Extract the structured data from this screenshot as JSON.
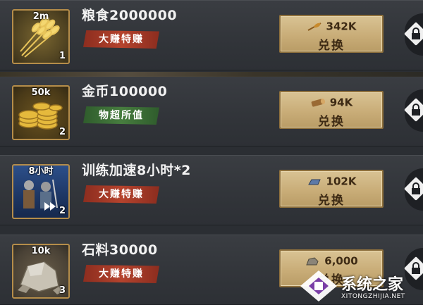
{
  "items": [
    {
      "quantity": "2m",
      "tier": "1",
      "name": "粮食2000000",
      "tag": "大赚特赚",
      "tag_style": "red",
      "cost": "342K",
      "cost_icon": "wheat-icon",
      "button_label": "兑换",
      "icon": "wheat-bundle-icon"
    },
    {
      "quantity": "50k",
      "tier": "2",
      "name": "金币100000",
      "tag": "物超所值",
      "tag_style": "green",
      "cost": "94K",
      "cost_icon": "wood-log-icon",
      "button_label": "兑换",
      "icon": "gold-coins-icon"
    },
    {
      "quantity": "8小时",
      "tier": "2",
      "name": "训练加速8小时*2",
      "tag": "大赚特赚",
      "tag_style": "red",
      "cost": "102K",
      "cost_icon": "iron-bar-icon",
      "button_label": "兑换",
      "icon": "soldiers-speedup-icon"
    },
    {
      "quantity": "10k",
      "tier": "3",
      "name": "石料30000",
      "tag": "大赚特赚",
      "tag_style": "red",
      "cost": "6,000",
      "cost_icon": "stone-icon",
      "button_label": "兑换",
      "icon": "stone-pile-icon"
    }
  ],
  "watermark": {
    "text": "系统之家",
    "url": "XITONGZHIJIA.NET"
  },
  "colors": {
    "row_bg": "#35383d",
    "icon_border": "#b58d4a",
    "button_bg": "#cdb07c",
    "tag_red": "#a63c28",
    "tag_green": "#3f7038"
  }
}
